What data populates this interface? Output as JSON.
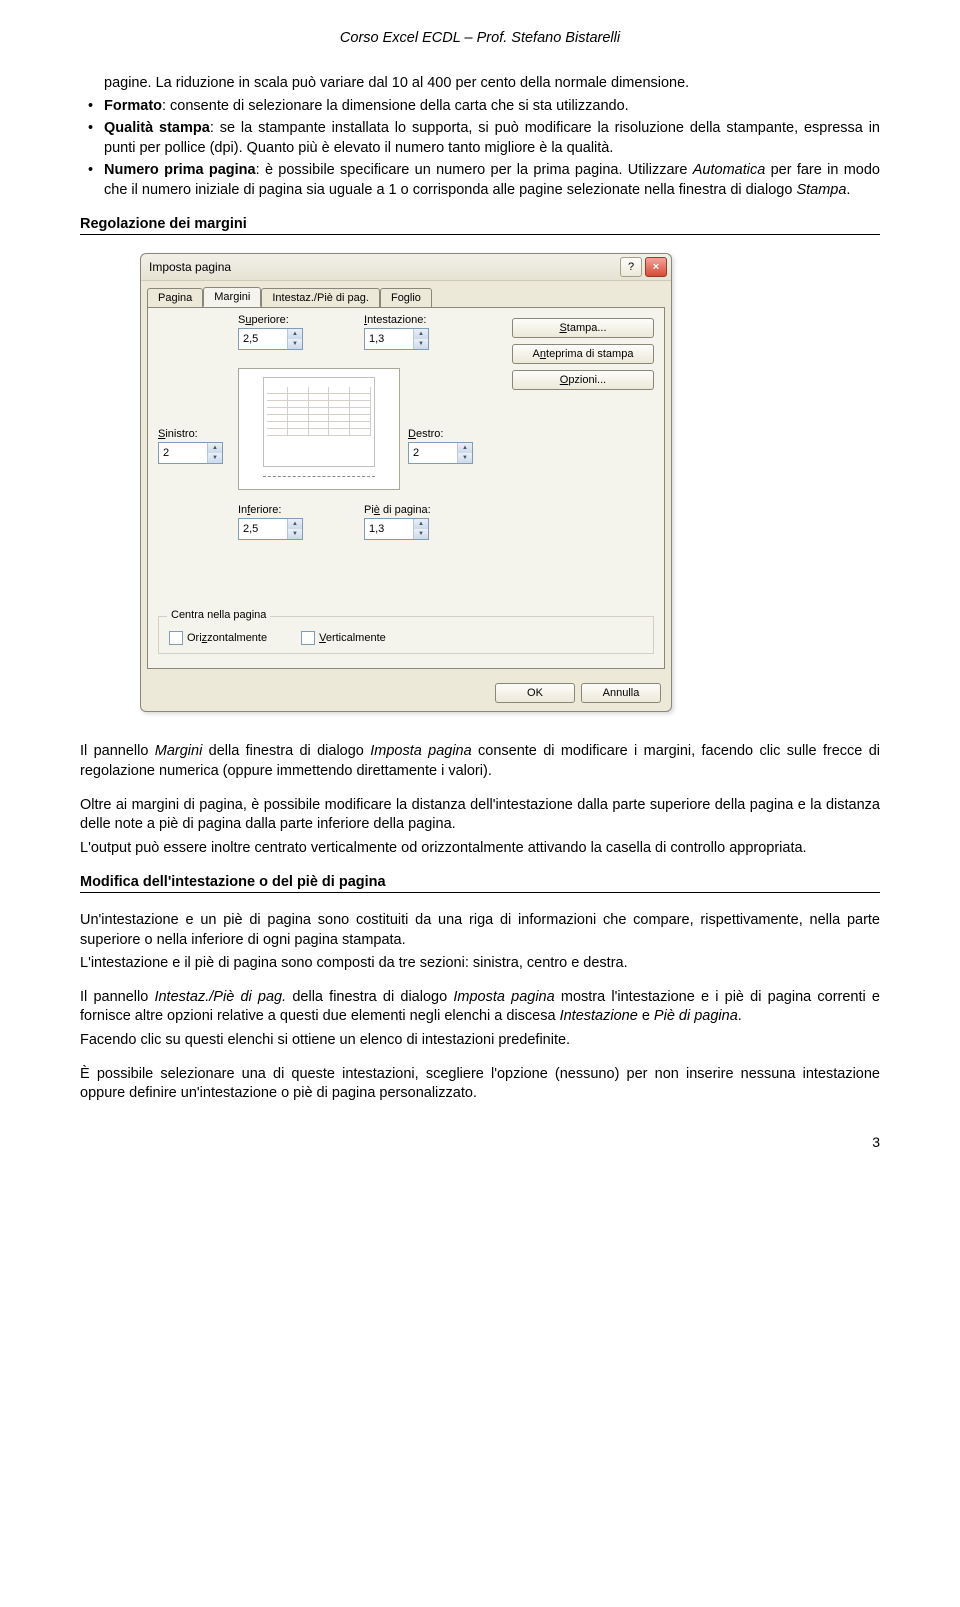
{
  "header": "Corso Excel ECDL – Prof. Stefano Bistarelli",
  "bullets": {
    "b1_pre": "pagine. La riduzione in scala può variare dal 10 al 400 per cento della normale dimensione.",
    "b2_lead": "Formato",
    "b2_body": ": consente di selezionare la dimensione della carta che si sta utilizzando.",
    "b3_lead": "Qualità stampa",
    "b3_body": ": se la stampante installata lo supporta, si può modificare la risoluzione della stampante, espressa in punti per pollice (dpi). Quanto più è elevato il numero tanto migliore è la qualità.",
    "b4_lead": "Numero prima pagina",
    "b4_body": ": è possibile specificare un numero per la prima pagina. Utilizzare ",
    "b4_em": "Automatica",
    "b4_tail": " per fare in modo che il numero iniziale di pagina sia uguale a 1 o corrisponda alle pagine selezionate nella finestra di dialogo ",
    "b4_em2": "Stampa",
    "b4_tail2": "."
  },
  "sections": {
    "s1": "Regolazione dei margini",
    "s2": "Modifica dell'intestazione o del piè  di pagina"
  },
  "dialog": {
    "title": "Imposta pagina",
    "help": "?",
    "close": "×",
    "tabs": [
      "Pagina",
      "Margini",
      "Intestaz./Piè di pag.",
      "Foglio"
    ],
    "labels": {
      "sup": "Superiore:",
      "int": "Intestazione:",
      "sin": "Sinistro:",
      "des": "Destro:",
      "inf": "Inferiore:",
      "pie": "Piè di pagina:"
    },
    "values": {
      "sup": "2,5",
      "int": "1,3",
      "sin": "2",
      "des": "2",
      "inf": "2,5",
      "pie": "1,3"
    },
    "right_buttons": {
      "stampa": "Stampa...",
      "anteprima": "Anteprima di stampa",
      "opzioni": "Opzioni..."
    },
    "group": {
      "legend": "Centra nella pagina",
      "oriz": "Orizzontalmente",
      "vert": "Verticalmente"
    },
    "footer": {
      "ok": "OK",
      "annulla": "Annulla"
    }
  },
  "body": {
    "p1a": "Il pannello ",
    "p1b": "Margini",
    "p1c": " della finestra di dialogo ",
    "p1d": "Imposta pagina",
    "p1e": " consente di modificare i margini, facendo clic sulle frecce di regolazione numerica (oppure immettendo direttamente i valori).",
    "p2": "Oltre ai margini di pagina, è possibile modificare la distanza dell'intestazione dalla parte superiore della pagina e la distanza delle note a piè di pagina dalla parte inferiore della pagina.",
    "p3": "L'output può essere inoltre centrato verticalmente od orizzontalmente attivando la casella di controllo appropriata.",
    "p4": "Un'intestazione e un piè di pagina sono costituiti da una riga di informazioni che compare, rispettivamente, nella parte superiore o nella inferiore di ogni pagina stampata.",
    "p5": "L'intestazione e il piè di pagina sono composti da tre sezioni: sinistra, centro e destra.",
    "p6a": "Il pannello ",
    "p6b": "Intestaz./Piè di pag.",
    "p6c": " della finestra di dialogo ",
    "p6d": "Imposta pagina",
    "p6e": " mostra l'intestazione e i piè di pagina correnti e fornisce altre opzioni relative a questi due elementi negli elenchi a discesa ",
    "p6f": "Intestazione",
    "p6g": " e ",
    "p6h": "Piè di pagina",
    "p6i": ".",
    "p7": "Facendo clic su questi elenchi si ottiene un elenco di intestazioni predefinite.",
    "p8": "È possibile selezionare una di queste intestazioni, scegliere l'opzione (nessuno) per non inserire nessuna intestazione oppure definire un'intestazione o piè di pagina personalizzato."
  },
  "pagenum": "3"
}
